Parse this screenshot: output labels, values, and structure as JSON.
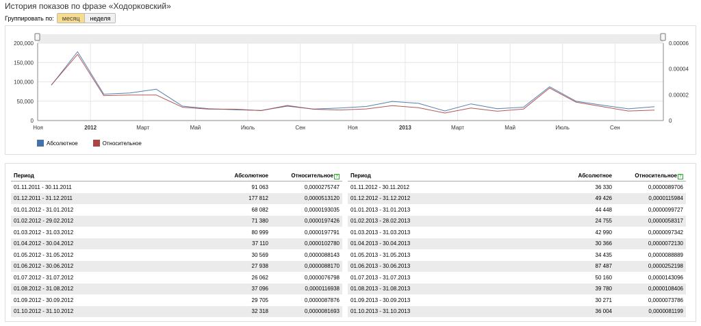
{
  "page": {
    "title": "История показов по фразе «Ходорковский»",
    "group_by_label": "Группировать по:",
    "group_options": [
      "месяц",
      "неделя"
    ],
    "group_selected": "месяц"
  },
  "chart_data": {
    "type": "line",
    "x": [
      "01.11.2011",
      "01.12.2011",
      "01.01.2012",
      "01.02.2012",
      "01.03.2012",
      "01.04.2012",
      "01.05.2012",
      "01.06.2012",
      "01.07.2012",
      "01.08.2012",
      "01.09.2012",
      "01.10.2012",
      "01.11.2012",
      "01.12.2012",
      "01.01.2013",
      "01.02.2013",
      "01.03.2013",
      "01.04.2013",
      "01.05.2013",
      "01.06.2013",
      "01.07.2013",
      "01.08.2013",
      "01.09.2013",
      "01.10.2013"
    ],
    "x_tick_labels": [
      "Ноя",
      "2012",
      "Март",
      "Май",
      "Июль",
      "Сен",
      "Ноя",
      "2013",
      "Март",
      "Май",
      "Июль",
      "Сен"
    ],
    "y_left_ticks": [
      "200,000",
      "150,000",
      "100,000",
      "50,000",
      "0"
    ],
    "y_right_ticks": [
      "0.00006",
      "0.00004",
      "0.00002",
      "0"
    ],
    "ylim_left": [
      0,
      200000
    ],
    "ylim_right": [
      0,
      6e-05
    ],
    "series": [
      {
        "name": "Абсолютное",
        "color": "#4572a7",
        "axis": "left",
        "values": [
          91063,
          177812,
          68082,
          71380,
          80999,
          37110,
          30569,
          27938,
          26062,
          37096,
          29705,
          32318,
          36330,
          49426,
          44448,
          24755,
          42990,
          30366,
          34435,
          87487,
          50160,
          39780,
          30271,
          36004
        ]
      },
      {
        "name": "Относительное",
        "color": "#aa4643",
        "axis": "right",
        "values": [
          2.75747e-05,
          5.1312e-05,
          1.93035e-05,
          1.97426e-05,
          1.97791e-05,
          1.0278e-05,
          8.8143e-06,
          8.817e-06,
          7.6798e-06,
          1.16938e-05,
          8.7876e-06,
          8.1693e-06,
          8.9706e-06,
          1.15984e-05,
          9.9727e-06,
          5.8317e-06,
          9.7342e-06,
          7.213e-06,
          8.8889e-06,
          2.52198e-05,
          1.43096e-05,
          1.08406e-05,
          7.3786e-06,
          8.1199e-06
        ]
      }
    ],
    "legend_placement": "bottom-left"
  },
  "table": {
    "headers": [
      "Период",
      "Абсолютное",
      "Относительное"
    ],
    "help_glyph": "?",
    "left_rows": [
      [
        "01.11.2011 - 30.11.2011",
        "91 063",
        "0,0000275747"
      ],
      [
        "01.12.2011 - 31.12.2011",
        "177 812",
        "0,0000513120"
      ],
      [
        "01.01.2012 - 31.01.2012",
        "68 082",
        "0,0000193035"
      ],
      [
        "01.02.2012 - 29.02.2012",
        "71 380",
        "0,0000197426"
      ],
      [
        "01.03.2012 - 31.03.2012",
        "80 999",
        "0,0000197791"
      ],
      [
        "01.04.2012 - 30.04.2012",
        "37 110",
        "0,0000102780"
      ],
      [
        "01.05.2012 - 31.05.2012",
        "30 569",
        "0,0000088143"
      ],
      [
        "01.06.2012 - 30.06.2012",
        "27 938",
        "0,0000088170"
      ],
      [
        "01.07.2012 - 31.07.2012",
        "26 062",
        "0,0000076798"
      ],
      [
        "01.08.2012 - 31.08.2012",
        "37 096",
        "0,0000116938"
      ],
      [
        "01.09.2012 - 30.09.2012",
        "29 705",
        "0,0000087876"
      ],
      [
        "01.10.2012 - 31.10.2012",
        "32 318",
        "0,0000081693"
      ]
    ],
    "right_rows": [
      [
        "01.11.2012 - 30.11.2012",
        "36 330",
        "0,0000089706"
      ],
      [
        "01.12.2012 - 31.12.2012",
        "49 426",
        "0,0000115984"
      ],
      [
        "01.01.2013 - 31.01.2013",
        "44 448",
        "0,0000099727"
      ],
      [
        "01.02.2013 - 28.02.2013",
        "24 755",
        "0,0000058317"
      ],
      [
        "01.03.2013 - 31.03.2013",
        "42 990",
        "0,0000097342"
      ],
      [
        "01.04.2013 - 30.04.2013",
        "30 366",
        "0,0000072130"
      ],
      [
        "01.05.2013 - 31.05.2013",
        "34 435",
        "0,0000088889"
      ],
      [
        "01.06.2013 - 30.06.2013",
        "87 487",
        "0,0000252198"
      ],
      [
        "01.07.2013 - 31.07.2013",
        "50 160",
        "0,0000143096"
      ],
      [
        "01.08.2013 - 31.08.2013",
        "39 780",
        "0,0000108406"
      ],
      [
        "01.09.2013 - 30.09.2013",
        "30 271",
        "0,0000073786"
      ],
      [
        "01.10.2013 - 31.10.2013",
        "36 004",
        "0,0000081199"
      ]
    ]
  }
}
